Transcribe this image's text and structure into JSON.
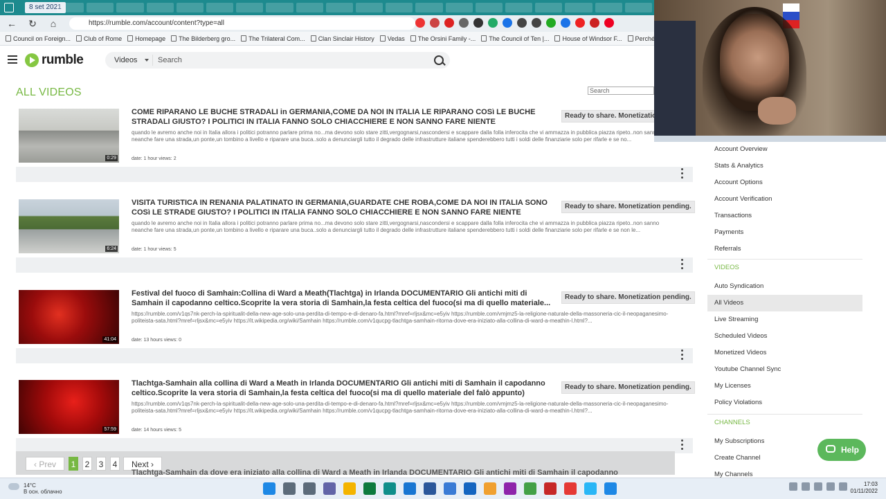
{
  "browser": {
    "date_tab": "8 set 2021",
    "url": "https://rumble.com/account/content?type=all",
    "bookmarks": [
      "Council on Foreign...",
      "Club of Rome",
      "Homepage",
      "The Bilderberg gro...",
      "The Trilateral Com...",
      "Clan Sinclair History",
      "Vedas",
      "The Orsini Family -...",
      "The Council of Ten |...",
      "House of Windsor F...",
      "Perché m..."
    ]
  },
  "header": {
    "logo_text": "rumble",
    "search_category": "Videos",
    "search_placeholder": "Search"
  },
  "page": {
    "title": "ALL VIDEOS",
    "list_search_placeholder": "Search"
  },
  "videos": [
    {
      "title": "COME RIPARANO LE BUCHE STRADALI in GERMANIA,COME DA NOI IN ITALIA LE RIPARANO COSì LE BUCHE STRADALI GIUSTO? I POLITICI IN ITALIA FANNO SOLO CHIACCHIERE E NON SANNO FARE NIENTE",
      "description": "quando le avremo anche noi in Italia allora i politici potranno parlare prima no...ma devono solo stare zitti,vergognarsi,nascondersi e scappare dalla folla inferocita che vi ammazza in pubblica piazza ripeto..non sanno neanche fare una strada,un ponte,un tombino a livello e riparare una buca..solo a denunciargli tutto il degrado delle infrastrutture italiane spenderebbero tutti i soldi delle finanziarie solo per rifarle e se no...",
      "meta": "date: 1 hour   views: 2",
      "duration": "0:29",
      "status": "Ready to share. Monetization pending."
    },
    {
      "title": "VISITA TURISTICA IN RENANIA PALATINATO IN GERMANIA,GUARDATE CHE ROBA,COME DA NOI IN ITALIA SONO COSì LE STRADE GIUSTO? I POLITICI IN ITALIA FANNO SOLO CHIACCHIERE E NON SANNO FARE NIENTE",
      "description": "quando le avremo anche noi in Italia allora i politici potranno parlare prima no...ma devono solo stare zitti,vergognarsi,nascondersi e scappare dalla folla inferocita che vi ammazza in pubblica piazza ripeto..non sanno neanche fare una strada,un ponte,un tombino a livello e riparare una buca..solo a denunciargli tutto il degrado delle infrastrutture italiane spenderebbero tutti i soldi delle finanziarie solo per rifarle e se non le...",
      "meta": "date: 1 hour   views: 5",
      "duration": "6:24",
      "status": "Ready to share. Monetization pending."
    },
    {
      "title": "Festival del fuoco di Samhain:Collina di Ward a Meath(Tlachtga) in Irlanda DOCUMENTARIO Gli antichi miti di Samhain il capodanno celtico.Scoprite la vera storia di Samhain,la festa celtica del fuoco(si ma di quello materiale...",
      "description": "https://rumble.com/v1qs7nk-perch-la-spiritualit-della-new-age-solo-una-perdita-di-tempo-e-di-denaro-fa.html?mref=rljsx&mc=e5yiv https://rumble.com/vmjmz5-la-religione-naturale-della-massoneria-cic-il-neopaganesimo-politeista-sata.html?mref=rljsx&mc=e5yiv https://it.wikipedia.org/wiki/Samhain https://rumble.com/v1qucpg-tlachtga-samhain-ritorna-dove-era-iniziato-alla-collina-di-ward-a-meathin-l.html?...",
      "meta": "date: 13 hours   views: 0",
      "duration": "41:04",
      "status": "Ready to share. Monetization pending."
    },
    {
      "title": "Tlachtga-Samhain alla collina di Ward a Meath in Irlanda DOCUMENTARIO Gli antichi miti di Samhain il capodanno celtico.Scoprite la vera storia di Samhain,la festa celtica del fuoco(si ma di quello materiale del falò appunto)",
      "description": "https://rumble.com/v1qs7nk-perch-la-spiritualit-della-new-age-solo-una-perdita-di-tempo-e-di-denaro-fa.html?mref=rljsx&mc=e5yiv https://rumble.com/vmjmz5-la-religione-naturale-della-massoneria-cic-il-neopaganesimo-politeista-sata.html?mref=rljsx&mc=e5yiv https://it.wikipedia.org/wiki/Samhain https://rumble.com/v1qucpg-tlachtga-samhain-ritorna-dove-era-iniziato-alla-collina-di-ward-a-meathin-l.html?...",
      "meta": "date: 14 hours   views: 5",
      "duration": "57:59",
      "status": "Ready to share. Monetization pending."
    }
  ],
  "next_peek_title": "Tlachtga-Samhain da dove era iniziato alla collina di Ward a Meath in Irlanda DOCUMENTARIO Gli antichi miti di Samhain il capodanno",
  "pagination": {
    "prev": "Prev",
    "pages": [
      "1",
      "2",
      "3",
      "4"
    ],
    "next": "Next"
  },
  "sidebar": {
    "account_items": [
      "Account Overview",
      "Stats & Analytics",
      "Account Options",
      "Account Verification",
      "Transactions",
      "Payments",
      "Referrals"
    ],
    "videos_heading": "VIDEOS",
    "video_items": [
      "Auto Syndication",
      "All Videos",
      "Live Streaming",
      "Scheduled Videos",
      "Monetized Videos",
      "Youtube Channel Sync",
      "My Licenses",
      "Policy Violations"
    ],
    "channels_heading": "CHANNELS",
    "channel_items": [
      "My Subscriptions",
      "Create Channel",
      "My Channels"
    ]
  },
  "help_label": "Help",
  "taskbar": {
    "weather_temp": "14°C",
    "weather_desc": "В осн. облачно",
    "time": "17:03",
    "date": "01/11/2022"
  },
  "colors": {
    "accent": "#77b843",
    "browser_tab": "#1d8a8e",
    "help": "#5cb85c"
  }
}
